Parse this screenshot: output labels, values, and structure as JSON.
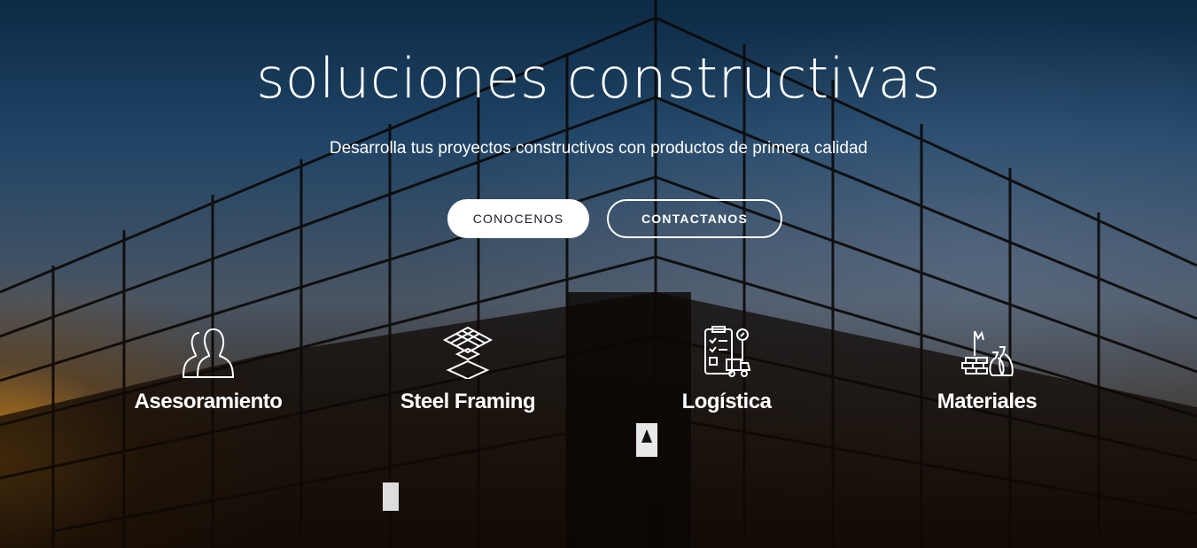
{
  "hero": {
    "title": "soluciones constructivas",
    "subtitle": "Desarrolla tus proyectos constructivos con productos de primera calidad",
    "buttons": [
      {
        "label": "CONOCENOS"
      },
      {
        "label": "CONTACTANOS"
      }
    ]
  },
  "features": [
    {
      "label": "Asesoramiento",
      "icon": "users-icon"
    },
    {
      "label": "Steel Framing",
      "icon": "layers-grid-icon"
    },
    {
      "label": "Logística",
      "icon": "clipboard-truck-icon"
    },
    {
      "label": "Materiales",
      "icon": "bricks-bags-icon"
    }
  ]
}
